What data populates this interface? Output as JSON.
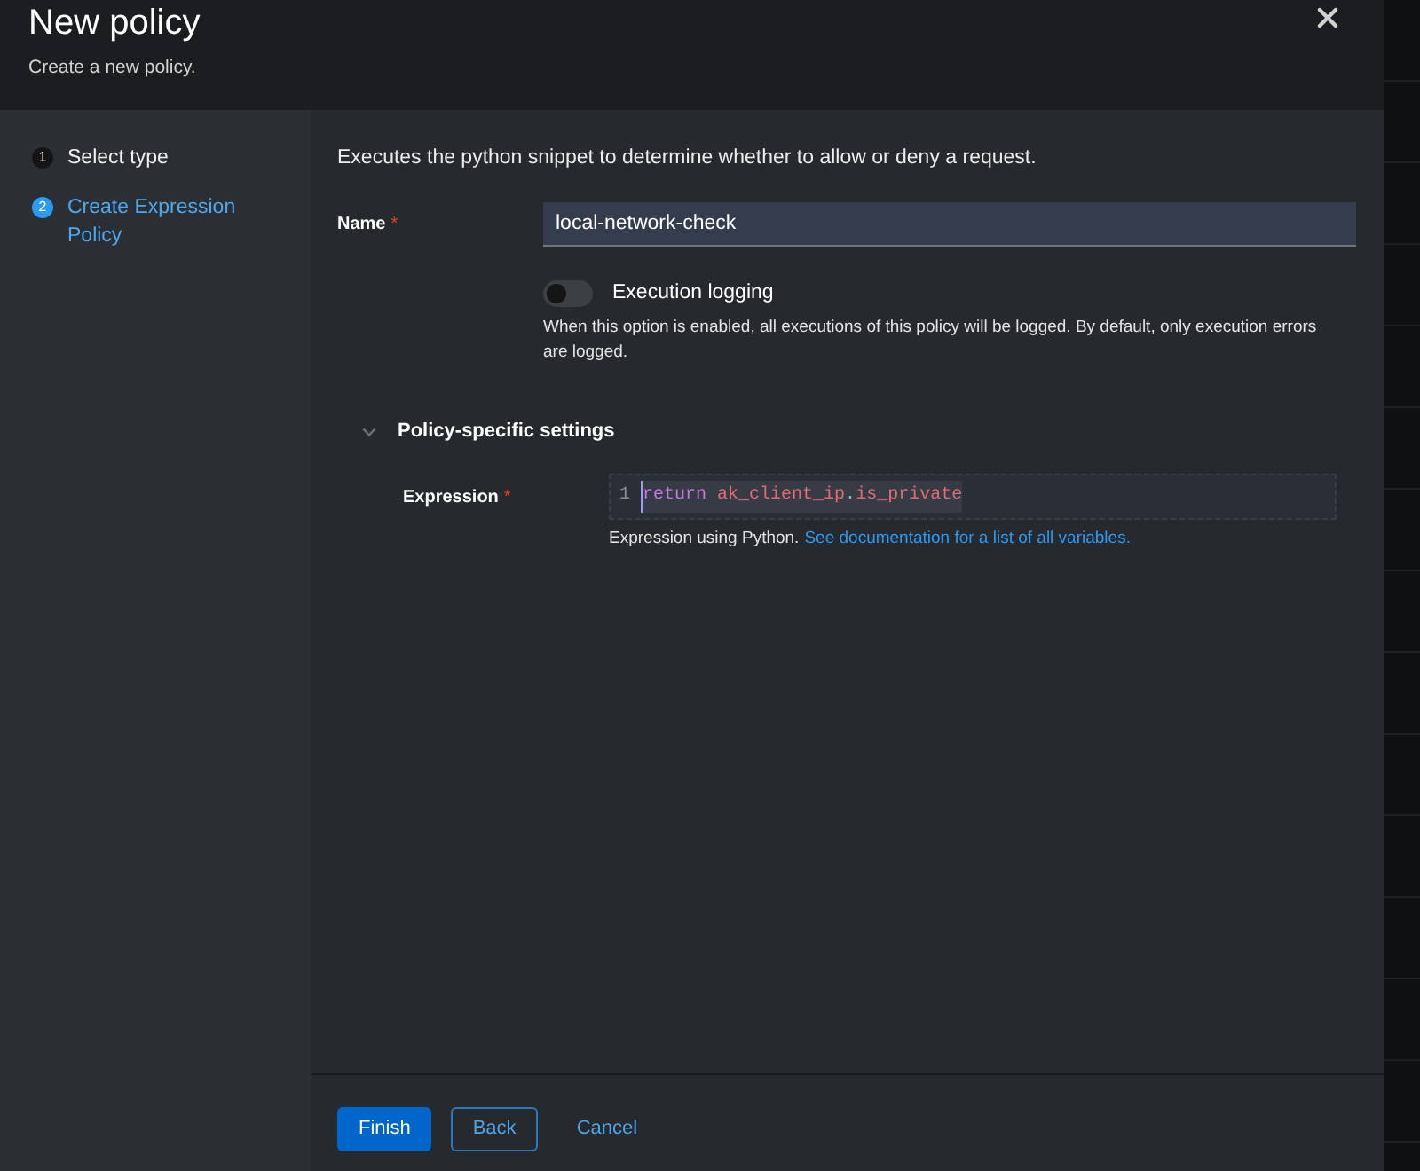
{
  "dialog": {
    "title": "New policy",
    "subtitle": "Create a new policy."
  },
  "steps": [
    {
      "number": "1",
      "label": "Select type",
      "selected": false
    },
    {
      "number": "2",
      "label": "Create Expression Policy",
      "selected": true
    }
  ],
  "description": "Executes the python snippet to determine whether to allow or deny a request.",
  "name_field": {
    "label": "Name",
    "required_mark": "*",
    "value": "local-network-check"
  },
  "execution_logging": {
    "label": "Execution logging",
    "on": false,
    "help": "When this option is enabled, all executions of this policy will be logged. By default, only execution errors are logged."
  },
  "policy_settings": {
    "title": "Policy-specific settings",
    "expanded": true,
    "expression": {
      "label": "Expression",
      "required_mark": "*",
      "line_number": "1",
      "code": [
        {
          "text": "return ",
          "kind": "keyword"
        },
        {
          "text": "ak_client_ip",
          "kind": "name"
        },
        {
          "text": ".",
          "kind": "punctuation"
        },
        {
          "text": "is_private",
          "kind": "name"
        }
      ],
      "help": "Expression using Python.",
      "link": "See documentation for a list of all variables."
    }
  },
  "buttons": [
    {
      "label": "Finish",
      "kind": "primary"
    },
    {
      "label": "Back",
      "kind": "secondary"
    },
    {
      "label": "Cancel",
      "kind": "link"
    }
  ]
}
